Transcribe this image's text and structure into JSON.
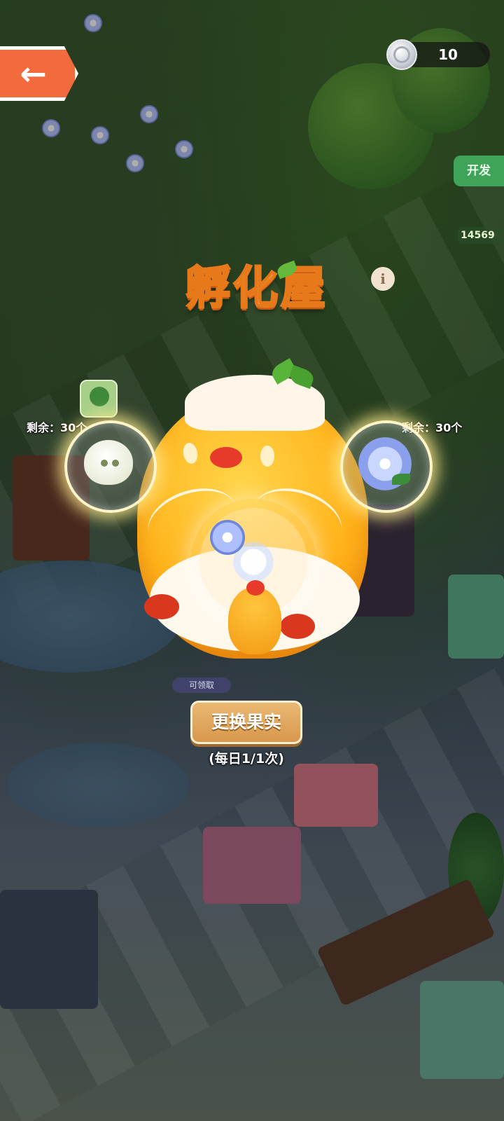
{
  "top_bar": {
    "coin_count": "10",
    "icons": [
      "back-arrow-icon",
      "silver-coin-icon"
    ]
  },
  "side_tags": {
    "dev_button": "开发",
    "score": "14569"
  },
  "hatchery": {
    "title": "孵化屋",
    "info_label": "i",
    "left_fruit": {
      "remaining": "剩余：30个",
      "icon": "seed-pod-icon"
    },
    "right_fruit": {
      "remaining": "剩余：30个",
      "icon": "lily-flower-icon"
    },
    "claim_label": "可领取",
    "swap_button": "更换果实",
    "daily_limit": "(每日1/1次)"
  },
  "colors": {
    "back_button": "#f26b3c",
    "title_outline": "#e8791b",
    "swap_button": "#d8974c",
    "chick_body": "#ffb21a"
  }
}
